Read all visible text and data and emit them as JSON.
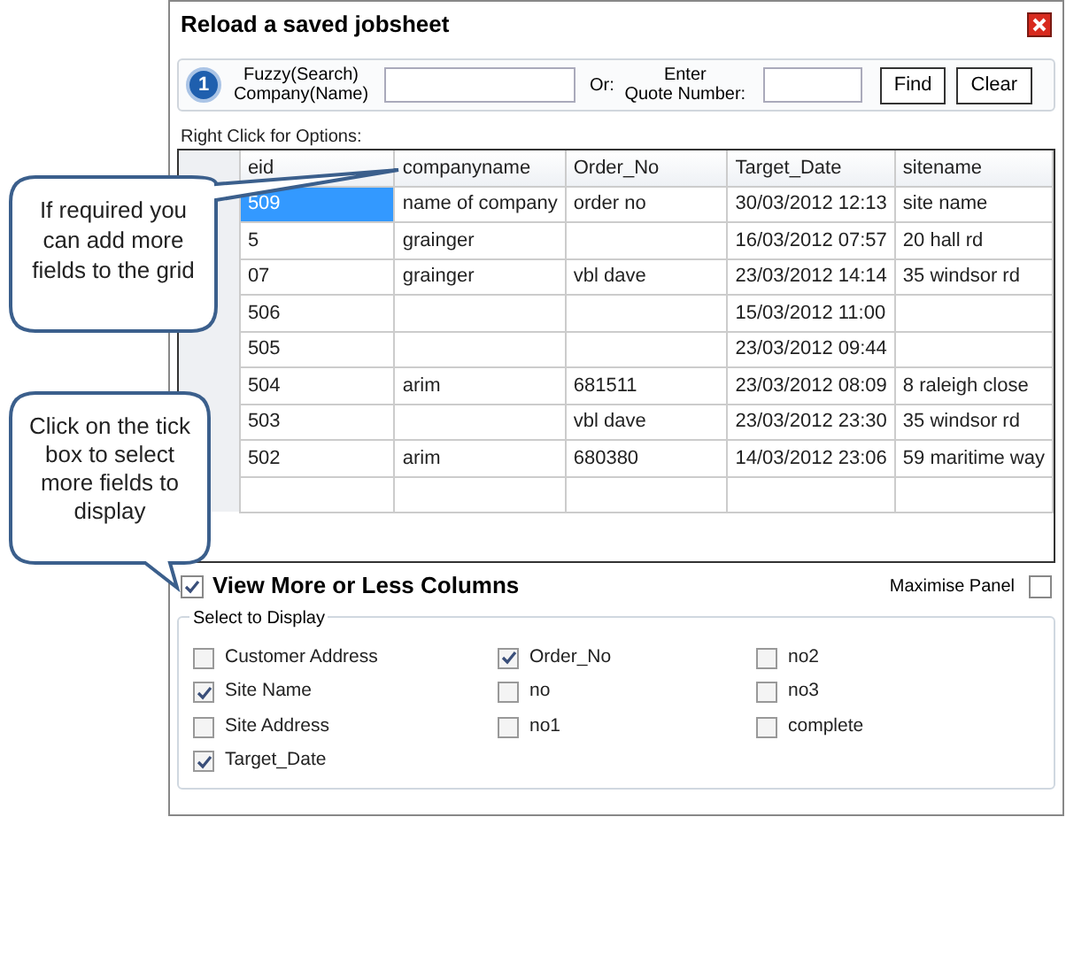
{
  "window": {
    "title": "Reload a saved jobsheet"
  },
  "search": {
    "step": "1",
    "company_label_1": "Fuzzy(Search)",
    "company_label_2": "Company(Name)",
    "or_label": "Or:",
    "quote_label_1": "Enter",
    "quote_label_2": "Quote Number:",
    "buttons": [
      "Find",
      "Clear"
    ]
  },
  "grid_hint": "Right Click for Options:",
  "table": {
    "columns": [
      "eid",
      "companyname",
      "Order_No",
      "Target_Date",
      "sitename"
    ],
    "rows": [
      {
        "selected": true,
        "cells": [
          "509",
          "name of company",
          "order no",
          "30/03/2012 12:13",
          "site name"
        ]
      },
      {
        "selected": false,
        "cells": [
          "5",
          "grainger",
          "",
          "16/03/2012 07:57",
          "20 hall rd"
        ]
      },
      {
        "selected": false,
        "cells": [
          "07",
          "grainger",
          "vbl dave",
          "23/03/2012 14:14",
          "35 windsor rd"
        ]
      },
      {
        "selected": false,
        "cells": [
          "506",
          "",
          "",
          "15/03/2012 11:00",
          ""
        ]
      },
      {
        "selected": false,
        "cells": [
          "505",
          "",
          "",
          "23/03/2012 09:44",
          ""
        ]
      },
      {
        "selected": false,
        "cells": [
          "504",
          "arim",
          "681511",
          "23/03/2012 08:09",
          "8 raleigh close"
        ]
      },
      {
        "selected": false,
        "cells": [
          "503",
          "",
          "vbl dave",
          "23/03/2012 23:30",
          "35 windsor rd"
        ]
      },
      {
        "selected": false,
        "cells": [
          "502",
          "arim",
          "680380",
          "14/03/2012 23:06",
          "59 maritime way"
        ]
      }
    ]
  },
  "view_more": {
    "label": "View More or Less Columns",
    "checked": true
  },
  "maximise": {
    "label": "Maximise Panel",
    "checked": false
  },
  "select_group": {
    "title": "Select to Display",
    "columns": [
      [
        {
          "label": "Customer Address",
          "checked": false
        },
        {
          "label": "Site Name",
          "checked": true
        },
        {
          "label": "Site Address",
          "checked": false
        },
        {
          "label": "Target_Date",
          "checked": true
        }
      ],
      [
        {
          "label": "Order_No",
          "checked": true
        },
        {
          "label": "no",
          "checked": false
        },
        {
          "label": "no1",
          "checked": false
        }
      ],
      [
        {
          "label": "no2",
          "checked": false
        },
        {
          "label": "no3",
          "checked": false
        },
        {
          "label": "complete",
          "checked": false
        }
      ]
    ]
  },
  "callouts": [
    {
      "text": "If required you can add more fields to the grid"
    },
    {
      "text": "Click on the tick box to select more fields to display"
    }
  ]
}
